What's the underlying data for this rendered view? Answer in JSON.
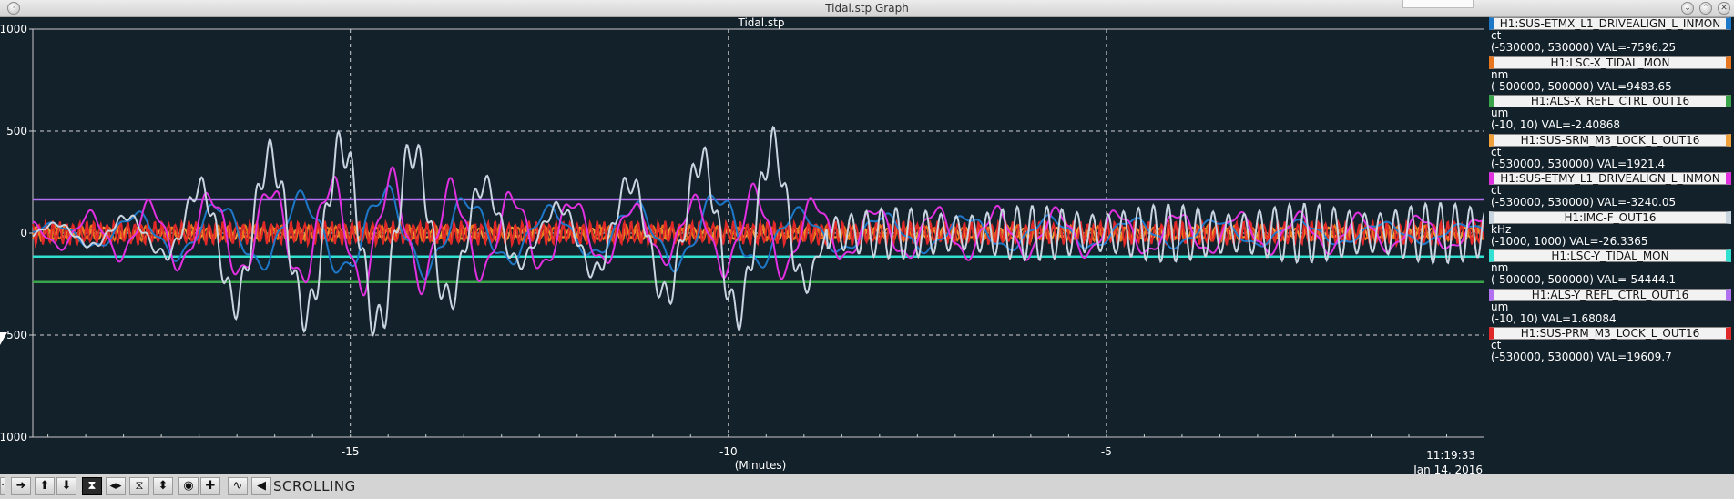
{
  "window": {
    "title": "Tidal.stp Graph"
  },
  "plot": {
    "title": "Tidal.stp",
    "xlabel": "(Minutes)",
    "timestamp_time": "11:19:33",
    "timestamp_date": "Jan 14, 2016"
  },
  "toolbar": {
    "mode_label": "SCROLLING"
  },
  "colors": {
    "background": "#13212b",
    "grid": "#d0d0d0"
  },
  "legend": [
    {
      "name": "H1:SUS-ETMX_L1_DRIVEALIGN_L_INMON",
      "unit": "ct",
      "range": "(-530000, 530000) VAL=-7596.25",
      "color": "#1e78c8"
    },
    {
      "name": "H1:LSC-X_TIDAL_MON",
      "unit": "nm",
      "range": "(-500000, 500000) VAL=9483.65",
      "color": "#e8761e"
    },
    {
      "name": "H1:ALS-X_REFL_CTRL_OUT16",
      "unit": "um",
      "range": "(-10, 10) VAL=-2.40868",
      "color": "#3aa44a"
    },
    {
      "name": "H1:SUS-SRM_M3_LOCK_L_OUT16",
      "unit": "ct",
      "range": "(-530000, 530000) VAL=1921.4",
      "color": "#f0a038"
    },
    {
      "name": "H1:SUS-ETMY_L1_DRIVEALIGN_L_INMON",
      "unit": "ct",
      "range": "(-530000, 530000) VAL=-3240.05",
      "color": "#e030e0"
    },
    {
      "name": "H1:IMC-F_OUT16",
      "unit": "kHz",
      "range": "(-1000, 1000) VAL=-26.3365",
      "color": "#c8d4e0"
    },
    {
      "name": "H1:LSC-Y_TIDAL_MON",
      "unit": "nm",
      "range": "(-500000, 500000) VAL=-54444.1",
      "color": "#30e0d0"
    },
    {
      "name": "H1:ALS-Y_REFL_CTRL_OUT16",
      "unit": "um",
      "range": "(-10, 10) VAL=1.68084",
      "color": "#b070f0"
    },
    {
      "name": "H1:SUS-PRM_M3_LOCK_L_OUT16",
      "unit": "ct",
      "range": "(-530000, 530000) VAL=19609.7",
      "color": "#e02828"
    }
  ],
  "chart_data": {
    "type": "line",
    "title": "Tidal.stp",
    "xlabel": "(Minutes)",
    "ylabel": "",
    "xlim": [
      -19.2,
      0
    ],
    "ylim": [
      -1000,
      1000
    ],
    "x_ticks": [
      -15,
      -10,
      -5
    ],
    "y_ticks": [
      1000,
      500,
      0,
      -500,
      -1000
    ],
    "y_tick_labels": [
      "1000",
      "500",
      "0",
      "500",
      "1000"
    ],
    "grid": true,
    "legend_placement": "right",
    "flat_lines": [
      {
        "name": "H1:ALS-Y_REFL_CTRL_OUT16",
        "y": 165
      },
      {
        "name": "H1:LSC-Y_TIDAL_MON",
        "y": -115
      },
      {
        "name": "H1:ALS-X_REFL_CTRL_OUT16",
        "y": -240
      }
    ],
    "series": [
      {
        "name": "H1:IMC-F_OUT16",
        "peak_envelope": [
          [
            -19.2,
            40
          ],
          [
            -17.5,
            120
          ],
          [
            -16.5,
            430
          ],
          [
            -14.5,
            560
          ],
          [
            -13.5,
            360
          ],
          [
            -12.5,
            120
          ],
          [
            -10.5,
            430
          ],
          [
            -9.3,
            530
          ],
          [
            -8.7,
            120
          ],
          [
            -5,
            140
          ],
          [
            0,
            150
          ]
        ]
      },
      {
        "name": "H1:SUS-ETMY_L1_DRIVEALIGN_L_INMON",
        "peak_envelope": [
          [
            -19.2,
            60
          ],
          [
            -16.5,
            250
          ],
          [
            -14.5,
            330
          ],
          [
            -13,
            230
          ],
          [
            -11,
            150
          ],
          [
            -9.5,
            260
          ],
          [
            -8.5,
            150
          ],
          [
            0,
            90
          ]
        ]
      },
      {
        "name": "H1:SUS-ETMX_L1_DRIVEALIGN_L_INMON",
        "peak_envelope": [
          [
            -19.2,
            40
          ],
          [
            -16.5,
            180
          ],
          [
            -14.5,
            250
          ],
          [
            -12,
            120
          ],
          [
            -10,
            230
          ],
          [
            -8.9,
            110
          ],
          [
            0,
            50
          ]
        ]
      },
      {
        "name": "H1:SUS-PRM_M3_LOCK_L_OUT16",
        "peak_envelope": [
          [
            -19.2,
            60
          ],
          [
            0,
            60
          ]
        ]
      },
      {
        "name": "H1:LSC-X_TIDAL_MON",
        "peak_envelope": [
          [
            -19.2,
            40
          ],
          [
            0,
            40
          ]
        ]
      },
      {
        "name": "H1:SUS-SRM_M3_LOCK_L_OUT16",
        "peak_envelope": [
          [
            -19.2,
            30
          ],
          [
            0,
            30
          ]
        ]
      }
    ]
  }
}
